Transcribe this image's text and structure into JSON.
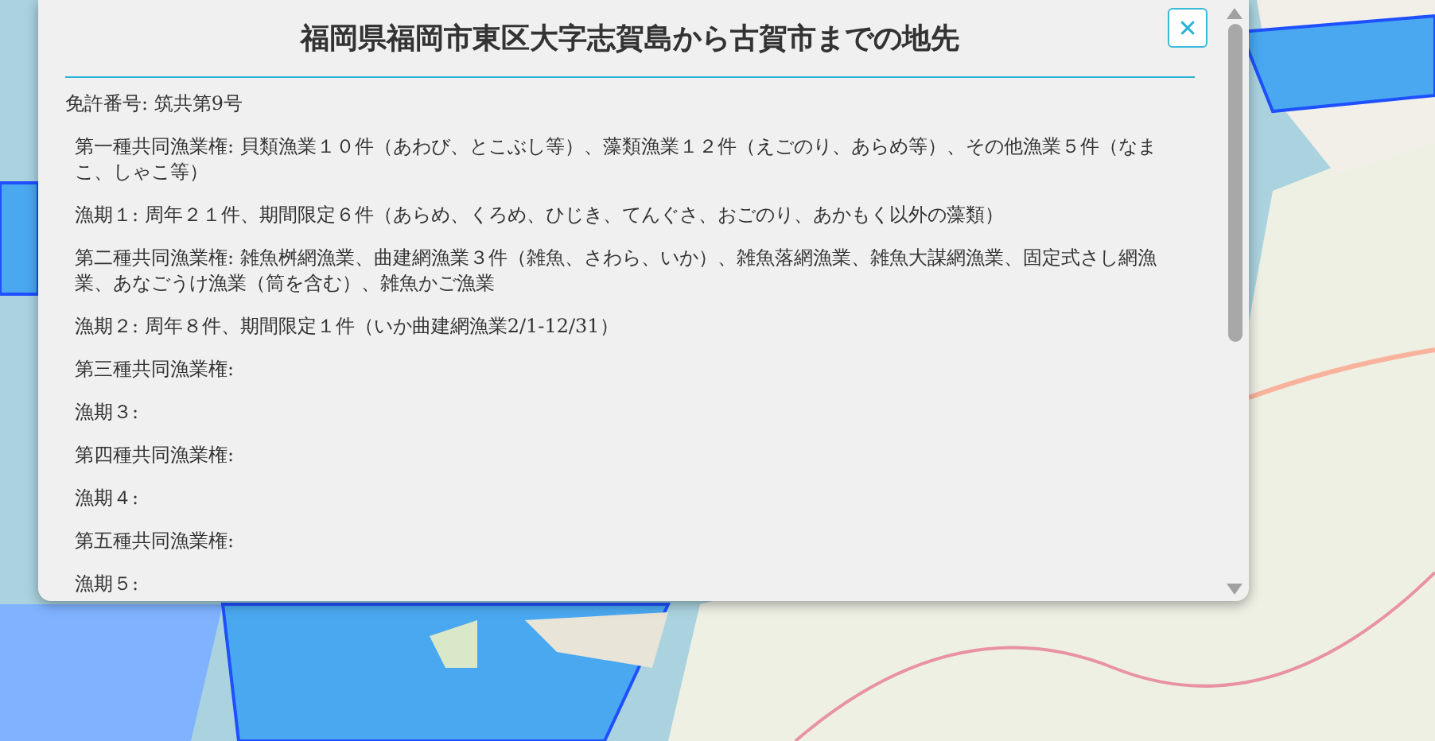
{
  "dialog": {
    "title": "福岡県福岡市東区大字志賀島から古賀市までの地先",
    "close_label": "✕",
    "paragraphs": [
      {
        "text": "免許番号: 筑共第9号",
        "indent": false
      },
      {
        "text": "第一種共同漁業権: 貝類漁業１０件（あわび、とこぶし等）、藻類漁業１２件（えごのり、あらめ等）、その他漁業５件（なまこ、しゃこ等）",
        "indent": true
      },
      {
        "text": "漁期１: 周年２１件、期間限定６件（あらめ、くろめ、ひじき、てんぐさ、おごのり、あかもく以外の藻類）",
        "indent": true
      },
      {
        "text": "第二種共同漁業権: 雑魚桝網漁業、曲建網漁業３件（雑魚、さわら、いか）、雑魚落網漁業、雑魚大謀網漁業、固定式さし網漁業、あなごうけ漁業（筒を含む）、雑魚かご漁業",
        "indent": true
      },
      {
        "text": "漁期２: 周年８件、期間限定１件（いか曲建網漁業2/1-12/31）",
        "indent": true
      },
      {
        "text": "第三種共同漁業権:",
        "indent": true
      },
      {
        "text": "漁期３:",
        "indent": true
      },
      {
        "text": "第四種共同漁業権:",
        "indent": true
      },
      {
        "text": "漁期４:",
        "indent": true
      },
      {
        "text": "第五種共同漁業権:",
        "indent": true
      },
      {
        "text": "漁期５:",
        "indent": true
      }
    ]
  }
}
